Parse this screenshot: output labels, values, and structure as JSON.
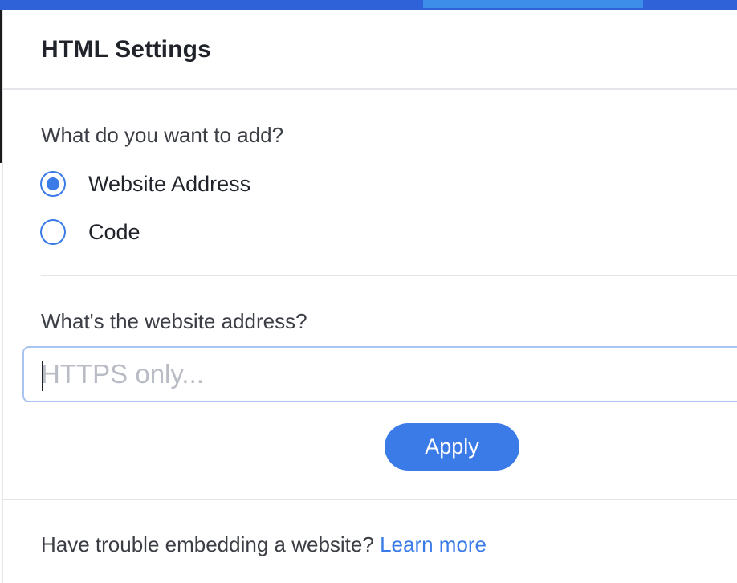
{
  "panel": {
    "title": "HTML Settings"
  },
  "content_type": {
    "question": "What do you want to add?",
    "options": [
      {
        "label": "Website Address",
        "checked": true
      },
      {
        "label": "Code",
        "checked": false
      }
    ]
  },
  "website": {
    "question": "What's the website address?",
    "input_value": "",
    "input_placeholder": "HTTPS only..."
  },
  "actions": {
    "apply_label": "Apply"
  },
  "footer": {
    "text": "Have trouble embedding a website?",
    "link_label": "Learn more"
  },
  "colors": {
    "accent": "#3b7be8",
    "topbar": "#2f62d8",
    "input_border_focus": "#a9c4f0",
    "divider": "#e3e5e8"
  }
}
